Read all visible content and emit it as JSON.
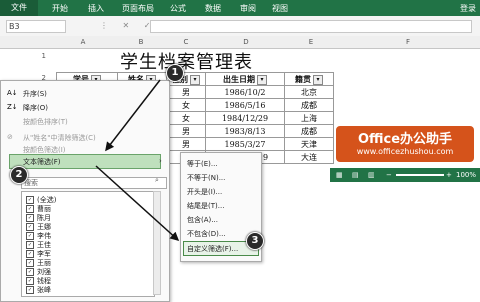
{
  "ribbon": {
    "file": "文件",
    "tabs": [
      "开始",
      "插入",
      "页面布局",
      "公式",
      "数据",
      "审阅",
      "视图"
    ],
    "login": "登录"
  },
  "formula": {
    "namebox": "B3",
    "fx": "fx"
  },
  "columns": [
    "A",
    "B",
    "C",
    "D",
    "E",
    "F"
  ],
  "rows": [
    "1",
    "2",
    "3",
    "4",
    "5",
    "6",
    "7",
    "8"
  ],
  "sheet": {
    "title": "学生档案管理表"
  },
  "table": {
    "headers": [
      "学号",
      "姓名",
      "性别",
      "出生日期",
      "籍贯"
    ],
    "rows": [
      [
        "男",
        "1986/10/2",
        "北京"
      ],
      [
        "女",
        "1986/5/16",
        "成都"
      ],
      [
        "女",
        "1984/12/29",
        "上海"
      ],
      [
        "男",
        "1983/8/13",
        "成都"
      ],
      [
        "男",
        "1985/3/27",
        "天津"
      ],
      [
        "男",
        "1986/11/19",
        "大连"
      ]
    ]
  },
  "status": {
    "zoom": "100%"
  },
  "menu": {
    "items": [
      "升序(S)",
      "降序(O)",
      "按颜色排序(T)",
      "从\"姓名\"中清除筛选(C)",
      "按颜色筛选(I)",
      "文本筛选(F)"
    ],
    "search_placeholder": "搜索",
    "list": [
      "(全选)",
      "曹丽",
      "陈月",
      "王娜",
      "李伟",
      "王佳",
      "李军",
      "王丽",
      "刘强",
      "钱程",
      "张峰"
    ]
  },
  "submenu": {
    "items": [
      "等于(E)...",
      "不等于(N)...",
      "开头是(I)...",
      "结尾是(T)...",
      "包含(A)...",
      "不包含(D)...",
      "自定义筛选(F)..."
    ]
  },
  "badges": [
    "1",
    "2",
    "3"
  ],
  "watermark": {
    "line1": "Office办公助手",
    "line2": "www.officezhushou.com"
  }
}
